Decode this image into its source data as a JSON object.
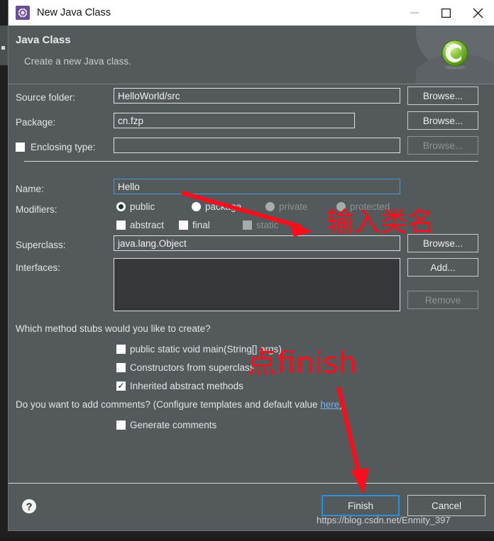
{
  "window": {
    "title": "New Java Class",
    "icon": "wizard-gear-icon",
    "controls": {
      "minimize": "minimize-icon",
      "maximize": "maximize-icon",
      "close": "close-icon"
    }
  },
  "header": {
    "title": "Java Class",
    "subtitle": "Create a new Java class.",
    "banner_icon": "java-class-green-c-icon"
  },
  "form": {
    "source_folder": {
      "label": "Source folder:",
      "value": "HelloWorld/src",
      "browse_label": "Browse..."
    },
    "package": {
      "label": "Package:",
      "value": "cn.fzp",
      "browse_label": "Browse..."
    },
    "enclosing_type": {
      "label": "Enclosing type:",
      "value": "",
      "checked": false,
      "browse_label": "Browse...",
      "browse_disabled": true
    },
    "name": {
      "label": "Name:",
      "value": "Hello",
      "focused": true
    },
    "modifiers": {
      "label": "Modifiers:",
      "radios": [
        {
          "label": "public",
          "checked": true,
          "disabled": false
        },
        {
          "label": "package",
          "checked": false,
          "disabled": false
        },
        {
          "label": "private",
          "checked": false,
          "disabled": true
        },
        {
          "label": "protected",
          "checked": false,
          "disabled": true
        }
      ],
      "checkboxes": [
        {
          "label": "abstract",
          "checked": false,
          "disabled": false
        },
        {
          "label": "final",
          "checked": false,
          "disabled": false
        },
        {
          "label": "static",
          "checked": false,
          "disabled": true
        }
      ]
    },
    "superclass": {
      "label": "Superclass:",
      "value": "java.lang.Object",
      "browse_label": "Browse..."
    },
    "interfaces": {
      "label": "Interfaces:",
      "items": [],
      "add_label": "Add...",
      "remove_label": "Remove",
      "remove_disabled": true
    },
    "method_stubs": {
      "question": "Which method stubs would you like to create?",
      "options": [
        {
          "label": "public static void main(String[] args)",
          "checked": false
        },
        {
          "label": "Constructors from superclass",
          "checked": false
        },
        {
          "label": "Inherited abstract methods",
          "checked": true
        }
      ]
    },
    "comments": {
      "question_prefix": "Do you want to add comments? (Configure templates and default value ",
      "link_label": "here",
      "question_suffix": ")",
      "option": {
        "label": "Generate comments",
        "checked": false
      }
    }
  },
  "footer": {
    "help_icon": "help-question-icon",
    "finish_label": "Finish",
    "cancel_label": "Cancel"
  },
  "watermark": "https://blog.csdn.net/Enmity_397",
  "annotations": {
    "color": "#fc0d1b",
    "note_name": "输入类名",
    "note_finish": "点finish"
  }
}
